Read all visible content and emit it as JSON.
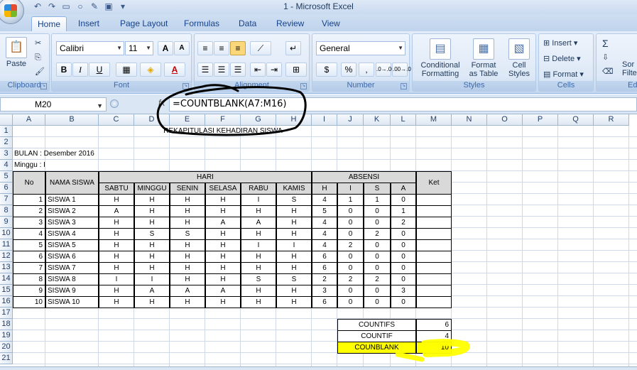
{
  "window": {
    "title": "1 - Microsoft Excel"
  },
  "tabs": [
    "Home",
    "Insert",
    "Page Layout",
    "Formulas",
    "Data",
    "Review",
    "View"
  ],
  "ribbon": {
    "clipboard": {
      "label": "Clipboard",
      "paste": "Paste"
    },
    "font": {
      "label": "Font",
      "name": "Calibri",
      "size": "11",
      "bold": "B",
      "italic": "I",
      "underline": "U",
      "grow": "A",
      "shrink": "A"
    },
    "alignment": {
      "label": "Alignment"
    },
    "number": {
      "label": "Number",
      "format": "General",
      "currency": "$",
      "percent": "%",
      "comma": ",",
      "inc_decimal": ".0→.00",
      "dec_decimal": ".00→.0"
    },
    "styles": {
      "label": "Styles",
      "conditional": "Conditional",
      "conditional2": "Formatting",
      "format": "Format",
      "format2": "as Table",
      "cell": "Cell",
      "cell2": "Styles"
    },
    "cells": {
      "label": "Cells",
      "insert": "Insert",
      "delete": "Delete",
      "format": "Format"
    },
    "editing": {
      "label": "Ed",
      "sigma": "Σ",
      "sort": "Sor",
      "filter": "Filte"
    }
  },
  "formula_bar": {
    "name_box": "M20",
    "fx": "fx",
    "formula": "=COUNTBLANK(A7:M16)"
  },
  "columns": [
    "A",
    "B",
    "C",
    "D",
    "E",
    "F",
    "G",
    "H",
    "I",
    "J",
    "K",
    "L",
    "M",
    "N",
    "O",
    "P",
    "Q",
    "R"
  ],
  "rows": [
    "1",
    "2",
    "3",
    "4",
    "5",
    "6",
    "7",
    "8",
    "9",
    "10",
    "11",
    "12",
    "13",
    "14",
    "15",
    "16",
    "17",
    "18",
    "19",
    "20",
    "21"
  ],
  "sheet": {
    "title": "REKAPITULASI KEHADIRAN SISWA",
    "bulan": "BULAN : Desember 2016",
    "minggu": "Minggu : I",
    "headers": {
      "no": "No",
      "nama": "NAMA SISWA",
      "hari": "HARI",
      "absensi": "ABSENSI",
      "ket": "Ket"
    },
    "days": [
      "SABTU",
      "MINGGU",
      "SENIN",
      "SELASA",
      "RABU",
      "KAMIS"
    ],
    "abs_cols": [
      "H",
      "I",
      "S",
      "A"
    ],
    "students": [
      {
        "no": "1",
        "name": "SISWA 1",
        "days": [
          "H",
          "H",
          "H",
          "H",
          "I",
          "S"
        ],
        "abs": [
          "4",
          "1",
          "1",
          "0"
        ]
      },
      {
        "no": "2",
        "name": "SISWA 2",
        "days": [
          "A",
          "H",
          "H",
          "H",
          "H",
          "H"
        ],
        "abs": [
          "5",
          "0",
          "0",
          "1"
        ]
      },
      {
        "no": "3",
        "name": "SISWA 3",
        "days": [
          "H",
          "H",
          "H",
          "A",
          "A",
          "H"
        ],
        "abs": [
          "4",
          "0",
          "0",
          "2"
        ]
      },
      {
        "no": "4",
        "name": "SISWA 4",
        "days": [
          "H",
          "S",
          "S",
          "H",
          "H",
          "H"
        ],
        "abs": [
          "4",
          "0",
          "2",
          "0"
        ]
      },
      {
        "no": "5",
        "name": "SISWA 5",
        "days": [
          "H",
          "H",
          "H",
          "H",
          "I",
          "I"
        ],
        "abs": [
          "4",
          "2",
          "0",
          "0"
        ]
      },
      {
        "no": "6",
        "name": "SISWA 6",
        "days": [
          "H",
          "H",
          "H",
          "H",
          "H",
          "H"
        ],
        "abs": [
          "6",
          "0",
          "0",
          "0"
        ]
      },
      {
        "no": "7",
        "name": "SISWA 7",
        "days": [
          "H",
          "H",
          "H",
          "H",
          "H",
          "H"
        ],
        "abs": [
          "6",
          "0",
          "0",
          "0"
        ]
      },
      {
        "no": "8",
        "name": "SISWA 8",
        "days": [
          "I",
          "I",
          "H",
          "H",
          "S",
          "S"
        ],
        "abs": [
          "2",
          "2",
          "2",
          "0"
        ]
      },
      {
        "no": "9",
        "name": "SISWA 9",
        "days": [
          "H",
          "A",
          "A",
          "A",
          "H",
          "H"
        ],
        "abs": [
          "3",
          "0",
          "0",
          "3"
        ]
      },
      {
        "no": "10",
        "name": "SISWA 10",
        "days": [
          "H",
          "H",
          "H",
          "H",
          "H",
          "H"
        ],
        "abs": [
          "6",
          "0",
          "0",
          "0"
        ]
      }
    ],
    "summary": [
      {
        "label": "COUNTIFS",
        "value": "6"
      },
      {
        "label": "COUNTIF",
        "value": "4"
      },
      {
        "label": "COUNBLANK",
        "value": "10"
      }
    ]
  },
  "colors": {
    "highlight": "#ffff00",
    "header_fill": "#d9d9d9",
    "ribbon_text": "#15428b"
  }
}
